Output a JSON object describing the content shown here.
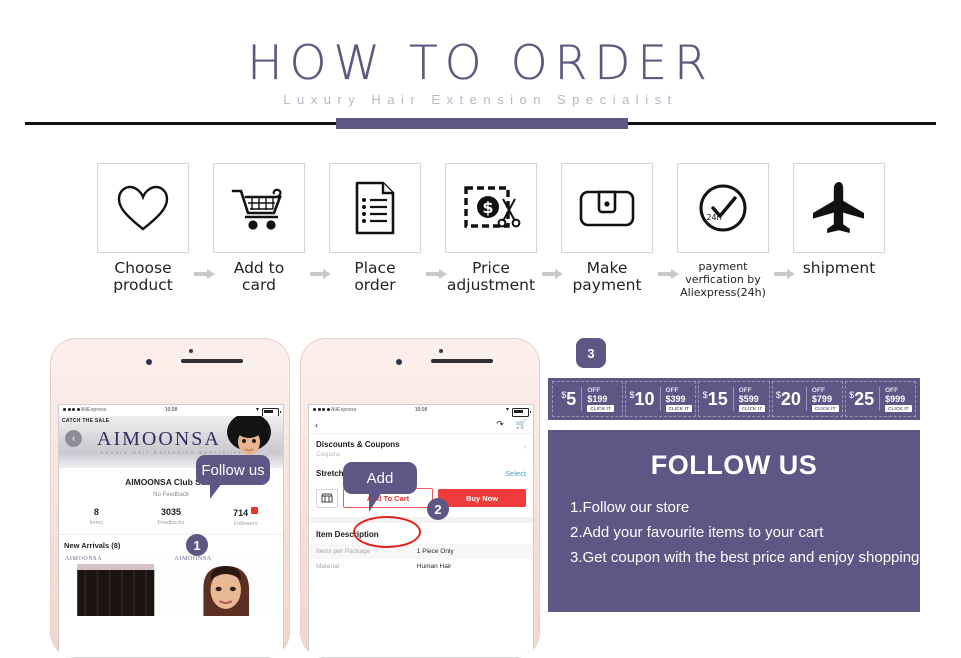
{
  "header": {
    "title": "HOW TO ORDER",
    "subtitle": "Luxury Hair Extension Specialist"
  },
  "steps": [
    {
      "icon": "heart-icon",
      "label": "Choose\nproduct"
    },
    {
      "icon": "cart-icon",
      "label": "Add to\ncard"
    },
    {
      "icon": "document-icon",
      "label": "Place\norder"
    },
    {
      "icon": "coupon-scissors-icon",
      "label": "Price\nadjustment"
    },
    {
      "icon": "wallet-icon",
      "label": "Make\npayment"
    },
    {
      "icon": "clock-check-icon",
      "label": "payment\nverfication by\nAliexpress(24h)",
      "clock_text": "24h",
      "small": true
    },
    {
      "icon": "airplane-icon",
      "label": "shipment"
    }
  ],
  "phone_store": {
    "status": {
      "carrier": "AliExpress",
      "time": "16:08"
    },
    "sale_tag": "CATCH THE SALE",
    "back_icon": "back-chevron-icon",
    "banner_logo": "AIMOONSA",
    "banner_tagline": "Luxury Hair Extension Specialist",
    "store_name": "AIMOONSA Club Store",
    "feedback": "No Feedback",
    "stats": [
      {
        "num": "8",
        "label": "Items"
      },
      {
        "num": "3035",
        "label": "Feedbacks"
      },
      {
        "num": "714",
        "label": "Followers"
      }
    ],
    "arrivals": "New Arrivals (8)",
    "thumb_watermark": "AIMOONSA",
    "bubble": "Follow us",
    "badge": "1"
  },
  "phone_product": {
    "status": {
      "carrier": "AliExpress",
      "time": "16:08"
    },
    "back_icon": "back-chevron-icon",
    "share_icon": "share-icon",
    "cart_icon": "cart-icon",
    "coupons_title": "Discounts & Coupons",
    "coupons_sub": "Coupons",
    "length_title": "Stretched Length",
    "select_label": "Select",
    "store_icon": "storefront-icon",
    "add_to_cart": "Add To Cart",
    "buy_now": "Buy Now",
    "desc_title": "Item Description",
    "desc_rows": [
      {
        "key": "Items per Package",
        "value": "1 Piece Only"
      },
      {
        "key": "Material",
        "value": "Human Hair"
      }
    ],
    "bubble": "Add",
    "badge": "2"
  },
  "coupon_badge": "3",
  "coupons": [
    {
      "amount": "5",
      "currency": "$",
      "off": "OFF",
      "min": "$199",
      "action": "CLICK IT"
    },
    {
      "amount": "10",
      "currency": "$",
      "off": "OFF",
      "min": "$399",
      "action": "CLICK IT"
    },
    {
      "amount": "15",
      "currency": "$",
      "off": "OFF",
      "min": "$599",
      "action": "CLICK IT"
    },
    {
      "amount": "20",
      "currency": "$",
      "off": "OFF",
      "min": "$799",
      "action": "CLICK IT"
    },
    {
      "amount": "25",
      "currency": "$",
      "off": "OFF",
      "min": "$999",
      "action": "CLICK IT"
    }
  ],
  "follow": {
    "title": "FOLLOW US",
    "items": [
      "1.Follow our store",
      "2.Add your favourite items to your cart",
      "3.Get coupon with the best price and enjoy shopping"
    ]
  },
  "colors": {
    "purple": "#5d5785",
    "red": "#ef3b3b",
    "title": "#5d5781"
  }
}
